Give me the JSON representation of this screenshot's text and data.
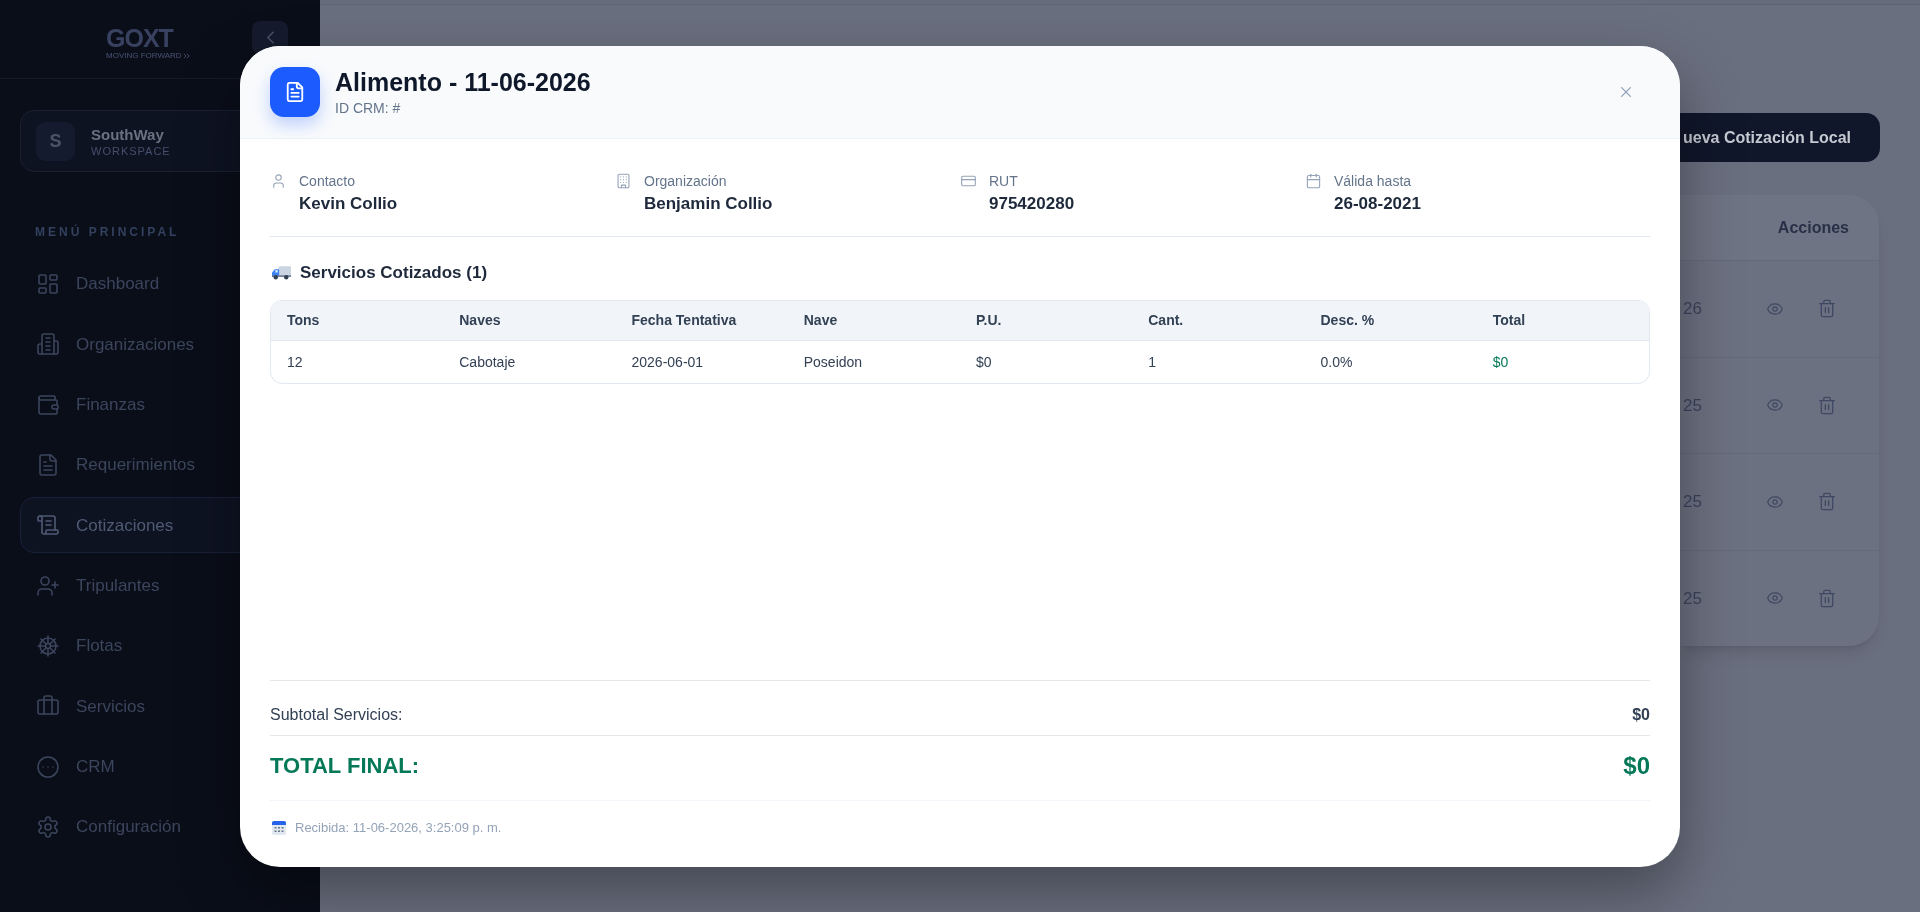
{
  "sidebar": {
    "logo": {
      "text": "GOXT",
      "tagline": "MOVING FORWARD"
    },
    "workspace": {
      "initial": "S",
      "name": "SouthWay",
      "label": "WORKSPACE"
    },
    "section_title": "MENÚ PRINCIPAL",
    "items": [
      {
        "label": "Dashboard",
        "selected": false
      },
      {
        "label": "Organizaciones",
        "selected": false
      },
      {
        "label": "Finanzas",
        "selected": false
      },
      {
        "label": "Requerimientos",
        "selected": false
      },
      {
        "label": "Cotizaciones",
        "selected": true
      },
      {
        "label": "Tripulantes",
        "selected": false
      },
      {
        "label": "Flotas",
        "selected": false
      },
      {
        "label": "Servicios",
        "selected": false
      },
      {
        "label": "CRM",
        "selected": false
      },
      {
        "label": "Configuración",
        "selected": false
      }
    ]
  },
  "page": {
    "new_quote_button": "ueva Cotización Local",
    "table": {
      "columns": [
        "Acciones"
      ],
      "rows": [
        {
          "column_1": "26"
        },
        {
          "column_1": "25"
        },
        {
          "column_1": "25"
        },
        {
          "column_1": "25"
        }
      ]
    }
  },
  "modal": {
    "title": "Alimento - 11-06-2026",
    "subtitle": "ID CRM: #",
    "fields": [
      {
        "label": "Contacto",
        "value": "Kevin Collio"
      },
      {
        "label": "Organización",
        "value": "Benjamin Collio"
      },
      {
        "label": "RUT",
        "value": "975420280"
      },
      {
        "label": "Válida hasta",
        "value": "26-08-2021"
      }
    ],
    "services": {
      "title": "Servicios Cotizados (1)",
      "columns": [
        "Tons",
        "Naves",
        "Fecha Tentativa",
        "Nave",
        "P.U.",
        "Cant.",
        "Desc. %",
        "Total"
      ],
      "rows": [
        [
          "12",
          "Cabotaje",
          "2026-06-01",
          "Poseidon",
          "$0",
          "1",
          "0.0%",
          "$0"
        ]
      ]
    },
    "subtotal": {
      "label": "Subtotal Servicios:",
      "value": "$0"
    },
    "total": {
      "label": "TOTAL FINAL:",
      "value": "$0"
    },
    "received": "Recibida: 11-06-2026, 3:25:09 p. m."
  }
}
